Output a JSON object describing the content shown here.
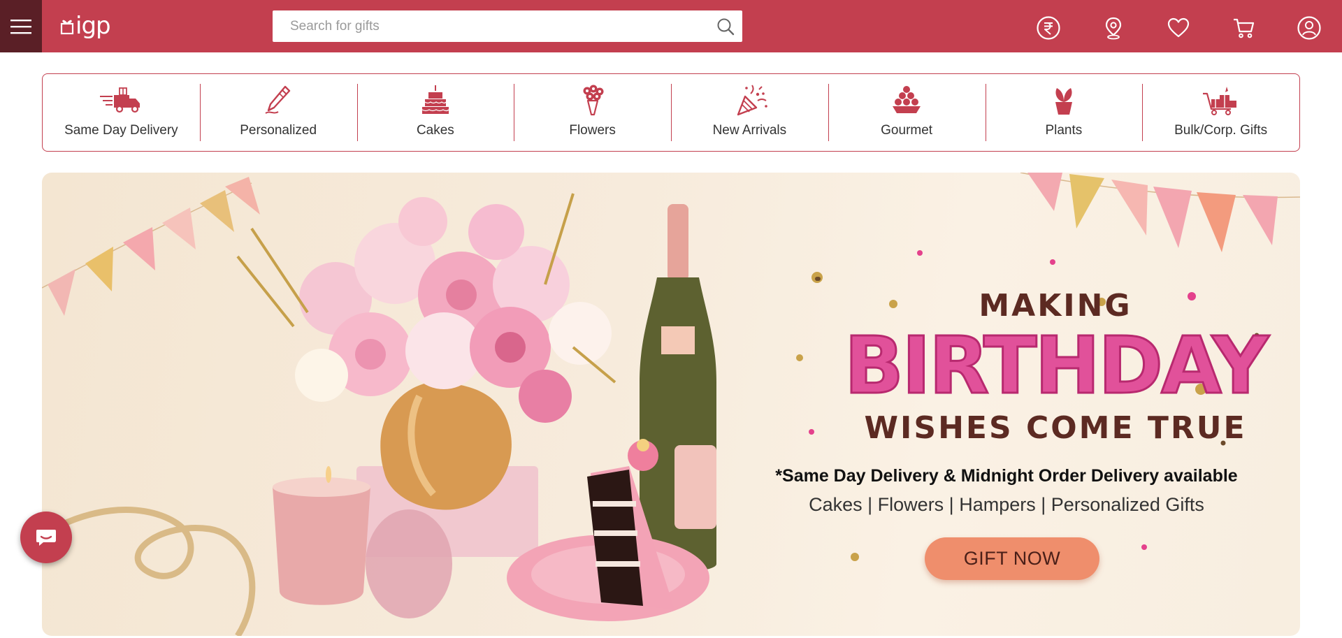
{
  "header": {
    "logo_text": "igp",
    "search": {
      "placeholder": "Search for gifts",
      "value": ""
    },
    "icons": [
      "rupee-currency-icon",
      "location-pin-icon",
      "heart-wishlist-icon",
      "cart-icon",
      "user-account-icon"
    ]
  },
  "categories": [
    {
      "label": "Same Day Delivery",
      "icon": "delivery-truck-icon"
    },
    {
      "label": "Personalized",
      "icon": "pencil-icon"
    },
    {
      "label": "Cakes",
      "icon": "cake-icon"
    },
    {
      "label": "Flowers",
      "icon": "flower-bouquet-icon"
    },
    {
      "label": "New Arrivals",
      "icon": "party-popper-icon"
    },
    {
      "label": "Gourmet",
      "icon": "sweets-icon"
    },
    {
      "label": "Plants",
      "icon": "potted-plant-icon"
    },
    {
      "label": "Bulk/Corp. Gifts",
      "icon": "gift-cart-icon"
    }
  ],
  "hero": {
    "line1": "MAKING",
    "line2": "BIRTHDAY",
    "line3": "WISHES COME TRUE",
    "delivery": "*Same Day Delivery & Midnight Order Delivery available",
    "cats": "Cakes | Flowers | Hampers | Personalized Gifts",
    "cta": "GIFT NOW"
  },
  "colors": {
    "brand": "#c33f4f",
    "brand_dark": "#5a1f26",
    "birthday_pink": "#e1519a",
    "cta": "#ef8e6c"
  }
}
